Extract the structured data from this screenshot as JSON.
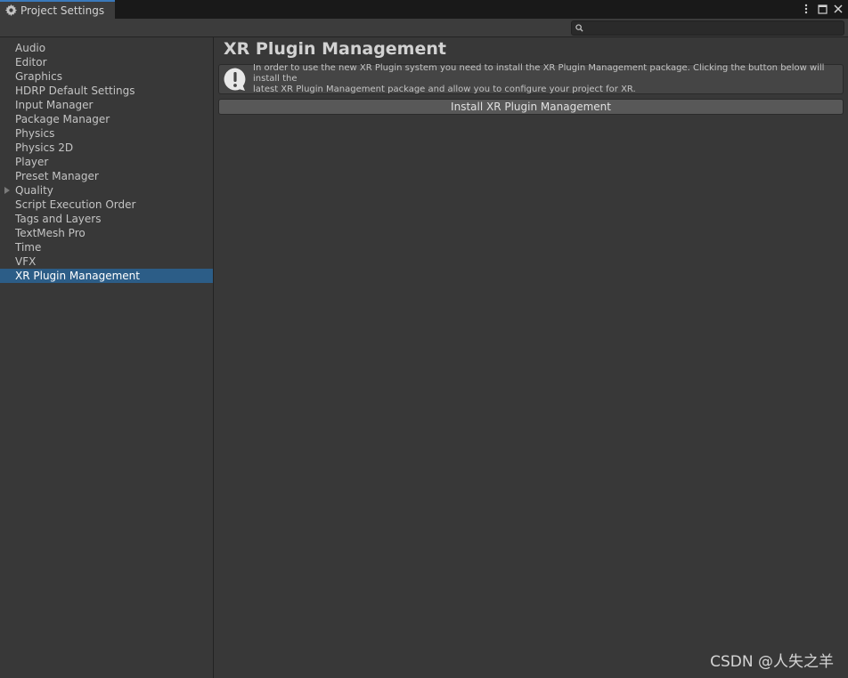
{
  "window": {
    "tab_label": "Project Settings",
    "tab_icon": "gear-icon"
  },
  "toolbar": {
    "search": {
      "value": "",
      "placeholder": ""
    }
  },
  "sidebar": {
    "items": [
      {
        "label": "Audio"
      },
      {
        "label": "Editor"
      },
      {
        "label": "Graphics"
      },
      {
        "label": "HDRP Default Settings"
      },
      {
        "label": "Input Manager"
      },
      {
        "label": "Package Manager"
      },
      {
        "label": "Physics"
      },
      {
        "label": "Physics 2D"
      },
      {
        "label": "Player"
      },
      {
        "label": "Preset Manager"
      },
      {
        "label": "Quality"
      },
      {
        "label": "Script Execution Order"
      },
      {
        "label": "Tags and Layers"
      },
      {
        "label": "TextMesh Pro"
      },
      {
        "label": "Time"
      },
      {
        "label": "VFX"
      },
      {
        "label": "XR Plugin Management"
      }
    ],
    "selected": "XR Plugin Management"
  },
  "main": {
    "title": "XR Plugin Management",
    "help": {
      "line1": "In order to use the new XR Plugin system you need to install the XR Plugin Management package. Clicking the button below will install the",
      "line2": "latest XR Plugin Management package and allow you to configure your project for XR."
    },
    "install_button": "Install XR Plugin Management"
  },
  "watermark": "CSDN @人失之羊",
  "colors": {
    "accent": "#3a79bb",
    "selection": "#2c5d87",
    "background": "#383838"
  }
}
